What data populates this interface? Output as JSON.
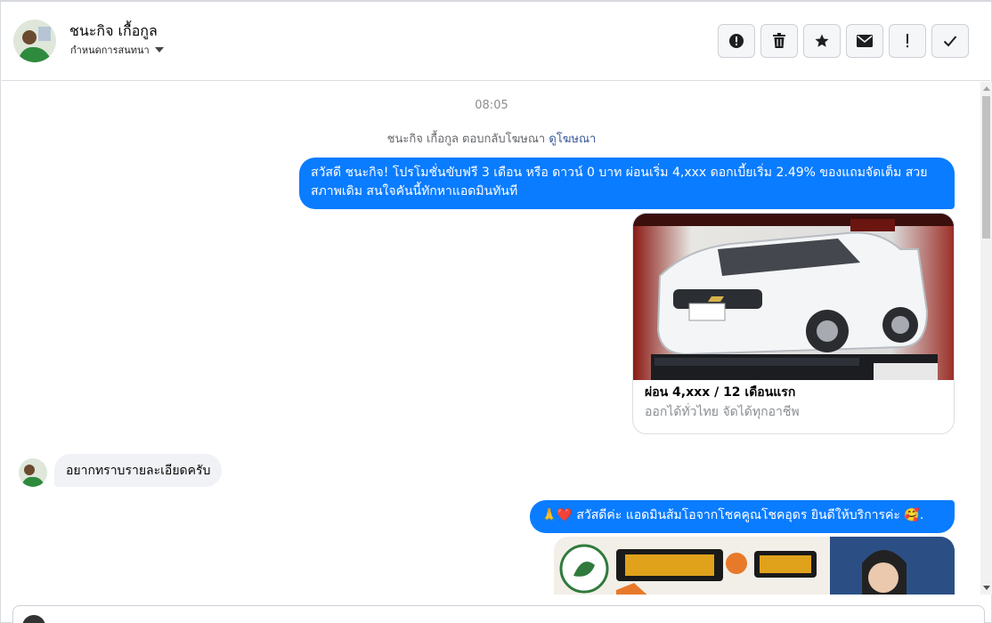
{
  "header": {
    "contact_name": "ชนะกิจ เกื้อกูล",
    "assign_label": "กำหนดการสนทนา",
    "actions": [
      {
        "name": "alert-icon"
      },
      {
        "name": "trash-icon"
      },
      {
        "name": "star-icon"
      },
      {
        "name": "envelope-icon"
      },
      {
        "name": "exclamation-icon"
      },
      {
        "name": "checkmark-icon"
      }
    ]
  },
  "chat": {
    "timestamp": "08:05",
    "ad_reply_prefix": "ชนะกิจ เกื้อกูล ตอบกลับโฆษณา",
    "ad_link": "ดูโฆษณา",
    "messages": {
      "m1": "สวัสดี ชนะกิจ! โปรโมชั่นขับฟรี 3 เดือน หรือ ดาวน์ 0 บาท ผ่อนเริ่ม 4,xxx ดอกเบี้ยเริ่ม 2.49% ของแถมจัดเต็ม สวยสภาพเดิม สนใจคันนี้ทักหาแอดมินทันที",
      "card_title": "ผ่อน 4,xxx / 12 เดือนแรก",
      "card_subtitle": "ออกได้ทั่วไทย จัดได้ทุกอาชีพ",
      "m2": "อยากทราบรายละเอียดครับ",
      "m3": "🙏❤️ สวัสดีค่ะ แอดมินส้มโอจากโชคคูณโชคอุดร ยินดีให้บริการค่ะ 🥰."
    }
  },
  "colors": {
    "outgoing_bubble": "#0a7cff",
    "incoming_bubble": "#f0f2f5",
    "link": "#385898"
  }
}
